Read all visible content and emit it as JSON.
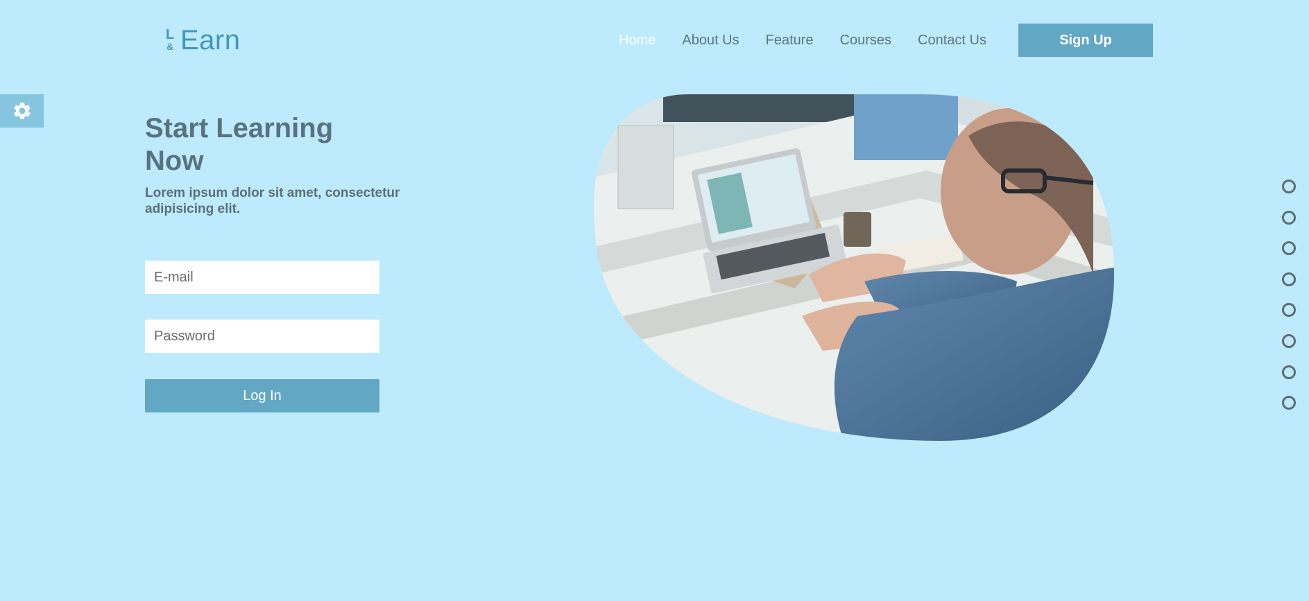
{
  "brand": {
    "logo_l": "L",
    "logo_amp": "&",
    "logo_text": "Earn",
    "color": "#3f97bd"
  },
  "nav": {
    "items": [
      {
        "label": "Home",
        "active": true
      },
      {
        "label": "About Us"
      },
      {
        "label": "Feature"
      },
      {
        "label": "Courses"
      },
      {
        "label": "Contact Us"
      }
    ],
    "signup_label": "Sign Up"
  },
  "sidebar": {
    "settings_icon": "gear-icon"
  },
  "hero": {
    "title": "Start Learning Now",
    "subtitle": "Lorem ipsum dolor sit amet, consectetur adipisicing elit."
  },
  "login_form": {
    "email_placeholder": "E-mail",
    "password_placeholder": "Password",
    "login_label": "Log In"
  },
  "pagination": {
    "count": 8
  },
  "colors": {
    "background": "#bdeafc",
    "accent": "#62a8c5",
    "heading": "#58737f"
  }
}
